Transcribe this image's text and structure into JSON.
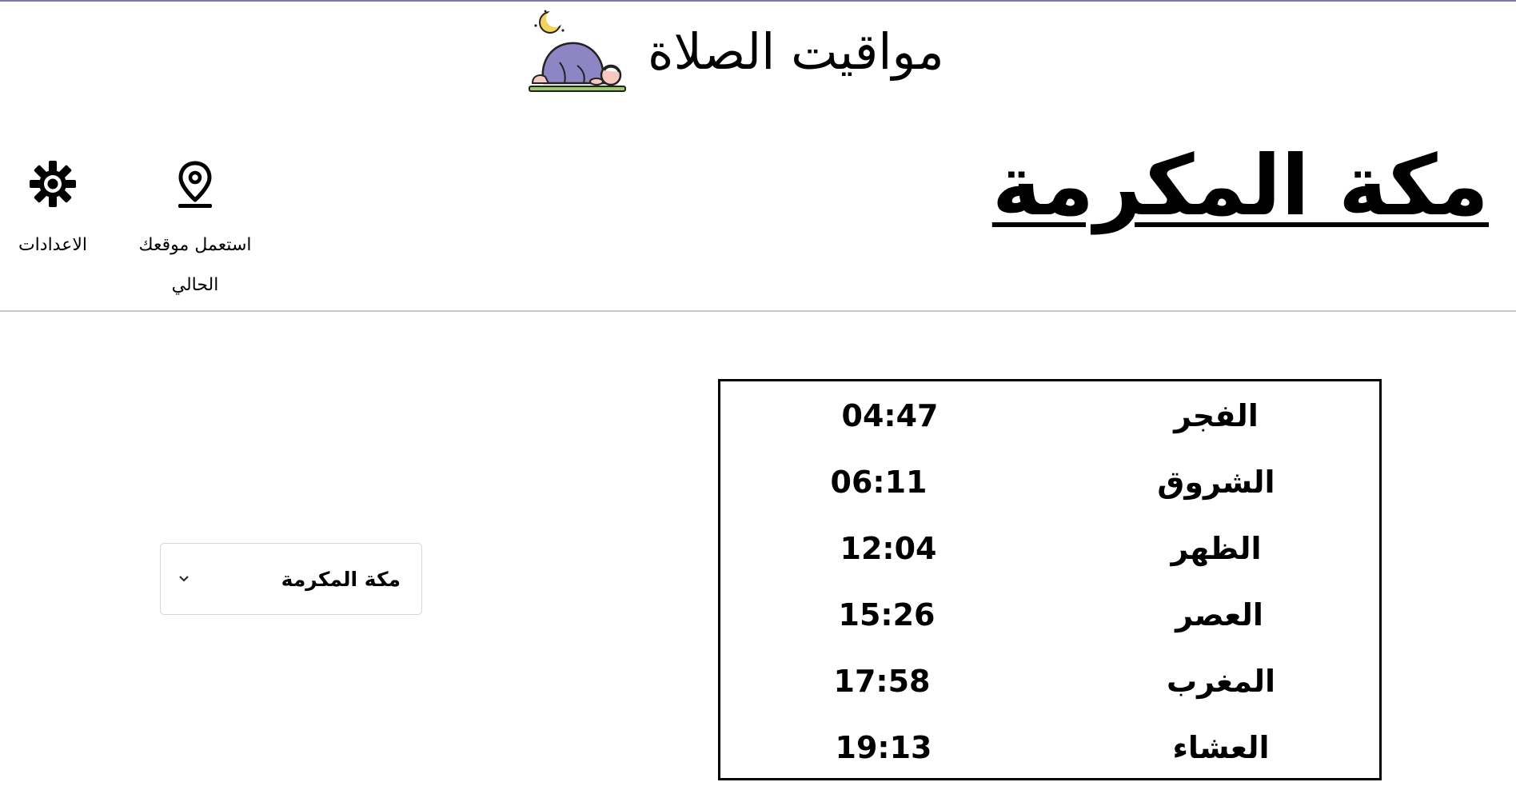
{
  "header": {
    "title": "مواقيت الصلاة",
    "logo_icon": "praying-person-crescent-icon"
  },
  "city": {
    "title": "مكة المكرمة"
  },
  "actions": {
    "location_label": "استعمل موقعك الحالي",
    "location_icon": "map-pin-icon",
    "settings_label": "الاعدادات",
    "settings_icon": "gear-icon"
  },
  "city_select": {
    "selected": "مكة المكرمة",
    "icon": "chevron-down-icon"
  },
  "prayers": [
    {
      "name": "الفجر",
      "time": "04:47"
    },
    {
      "name": "الشروق",
      "time": "06:11"
    },
    {
      "name": "الظهر",
      "time": "12:04"
    },
    {
      "name": "العصر",
      "time": "15:26"
    },
    {
      "name": "المغرب",
      "time": "17:58"
    },
    {
      "name": "العشاء",
      "time": "19:13"
    }
  ],
  "colors": {
    "top_border": "#7a7aa8",
    "figure_robe": "#8e86c4",
    "moon": "#f2d45c",
    "mat": "#9cc96b"
  }
}
